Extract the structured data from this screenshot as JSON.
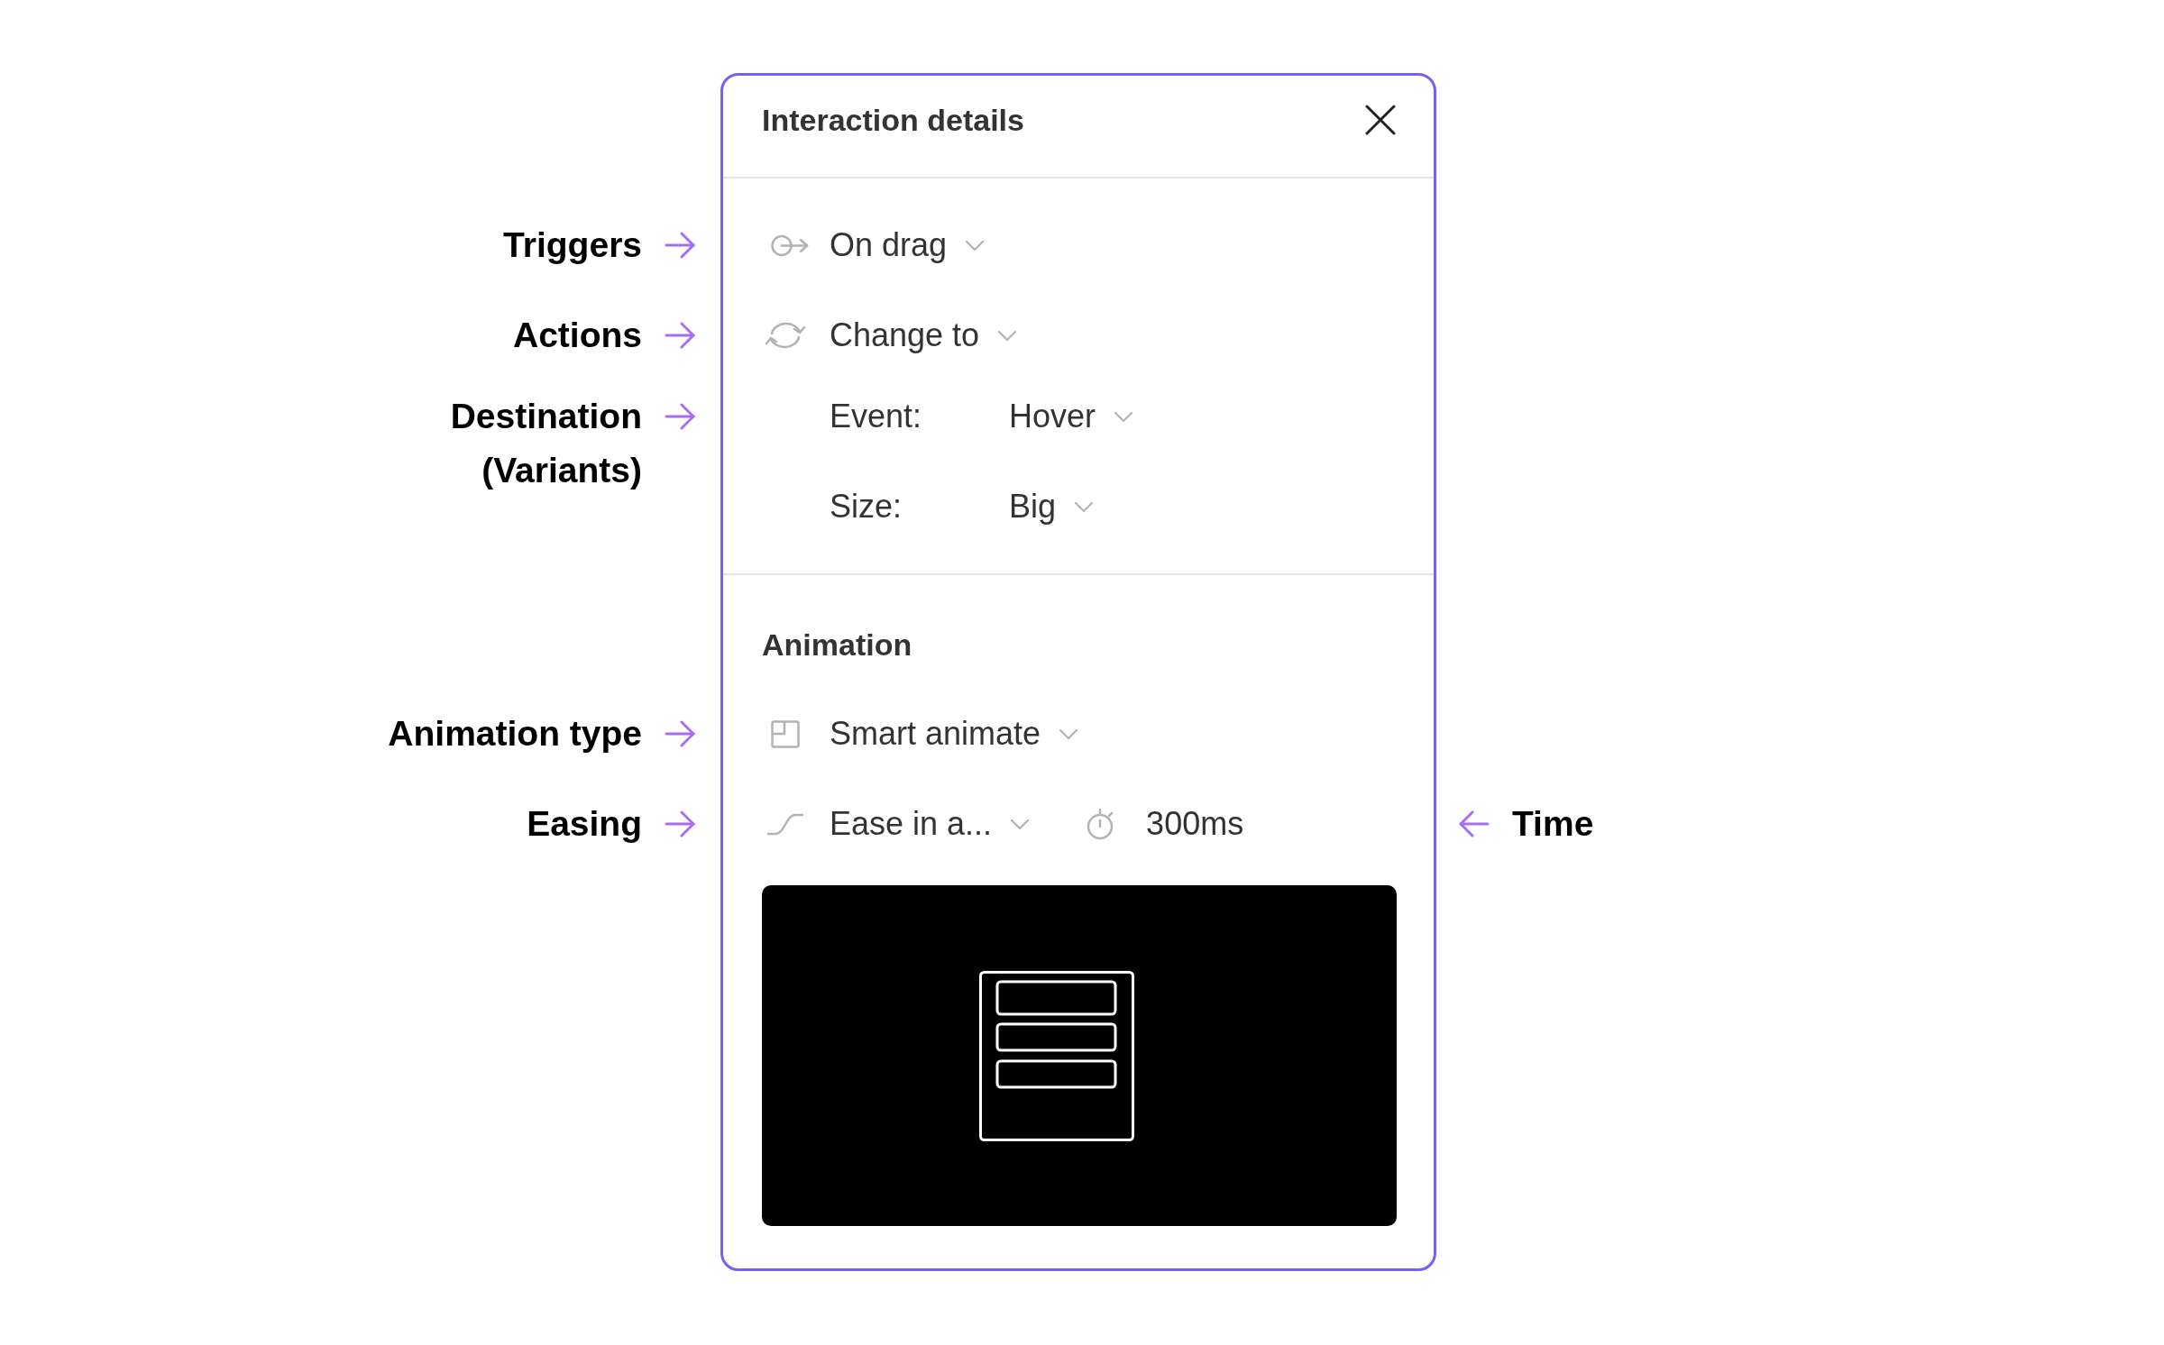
{
  "panel": {
    "title": "Interaction details",
    "trigger": {
      "value": "On drag",
      "callout": "Triggers"
    },
    "action": {
      "value": "Change to",
      "callout": "Actions"
    },
    "destination": {
      "callout": "Destination (Variants)",
      "properties": [
        {
          "label": "Event:",
          "value": "Hover"
        },
        {
          "label": "Size:",
          "value": "Big"
        }
      ]
    },
    "animation": {
      "heading": "Animation",
      "type": {
        "value": "Smart animate",
        "callout": "Animation type"
      },
      "easing": {
        "value": "Ease in a...",
        "callout": "Easing"
      },
      "duration": {
        "value": "300ms",
        "callout": "Time"
      }
    }
  }
}
